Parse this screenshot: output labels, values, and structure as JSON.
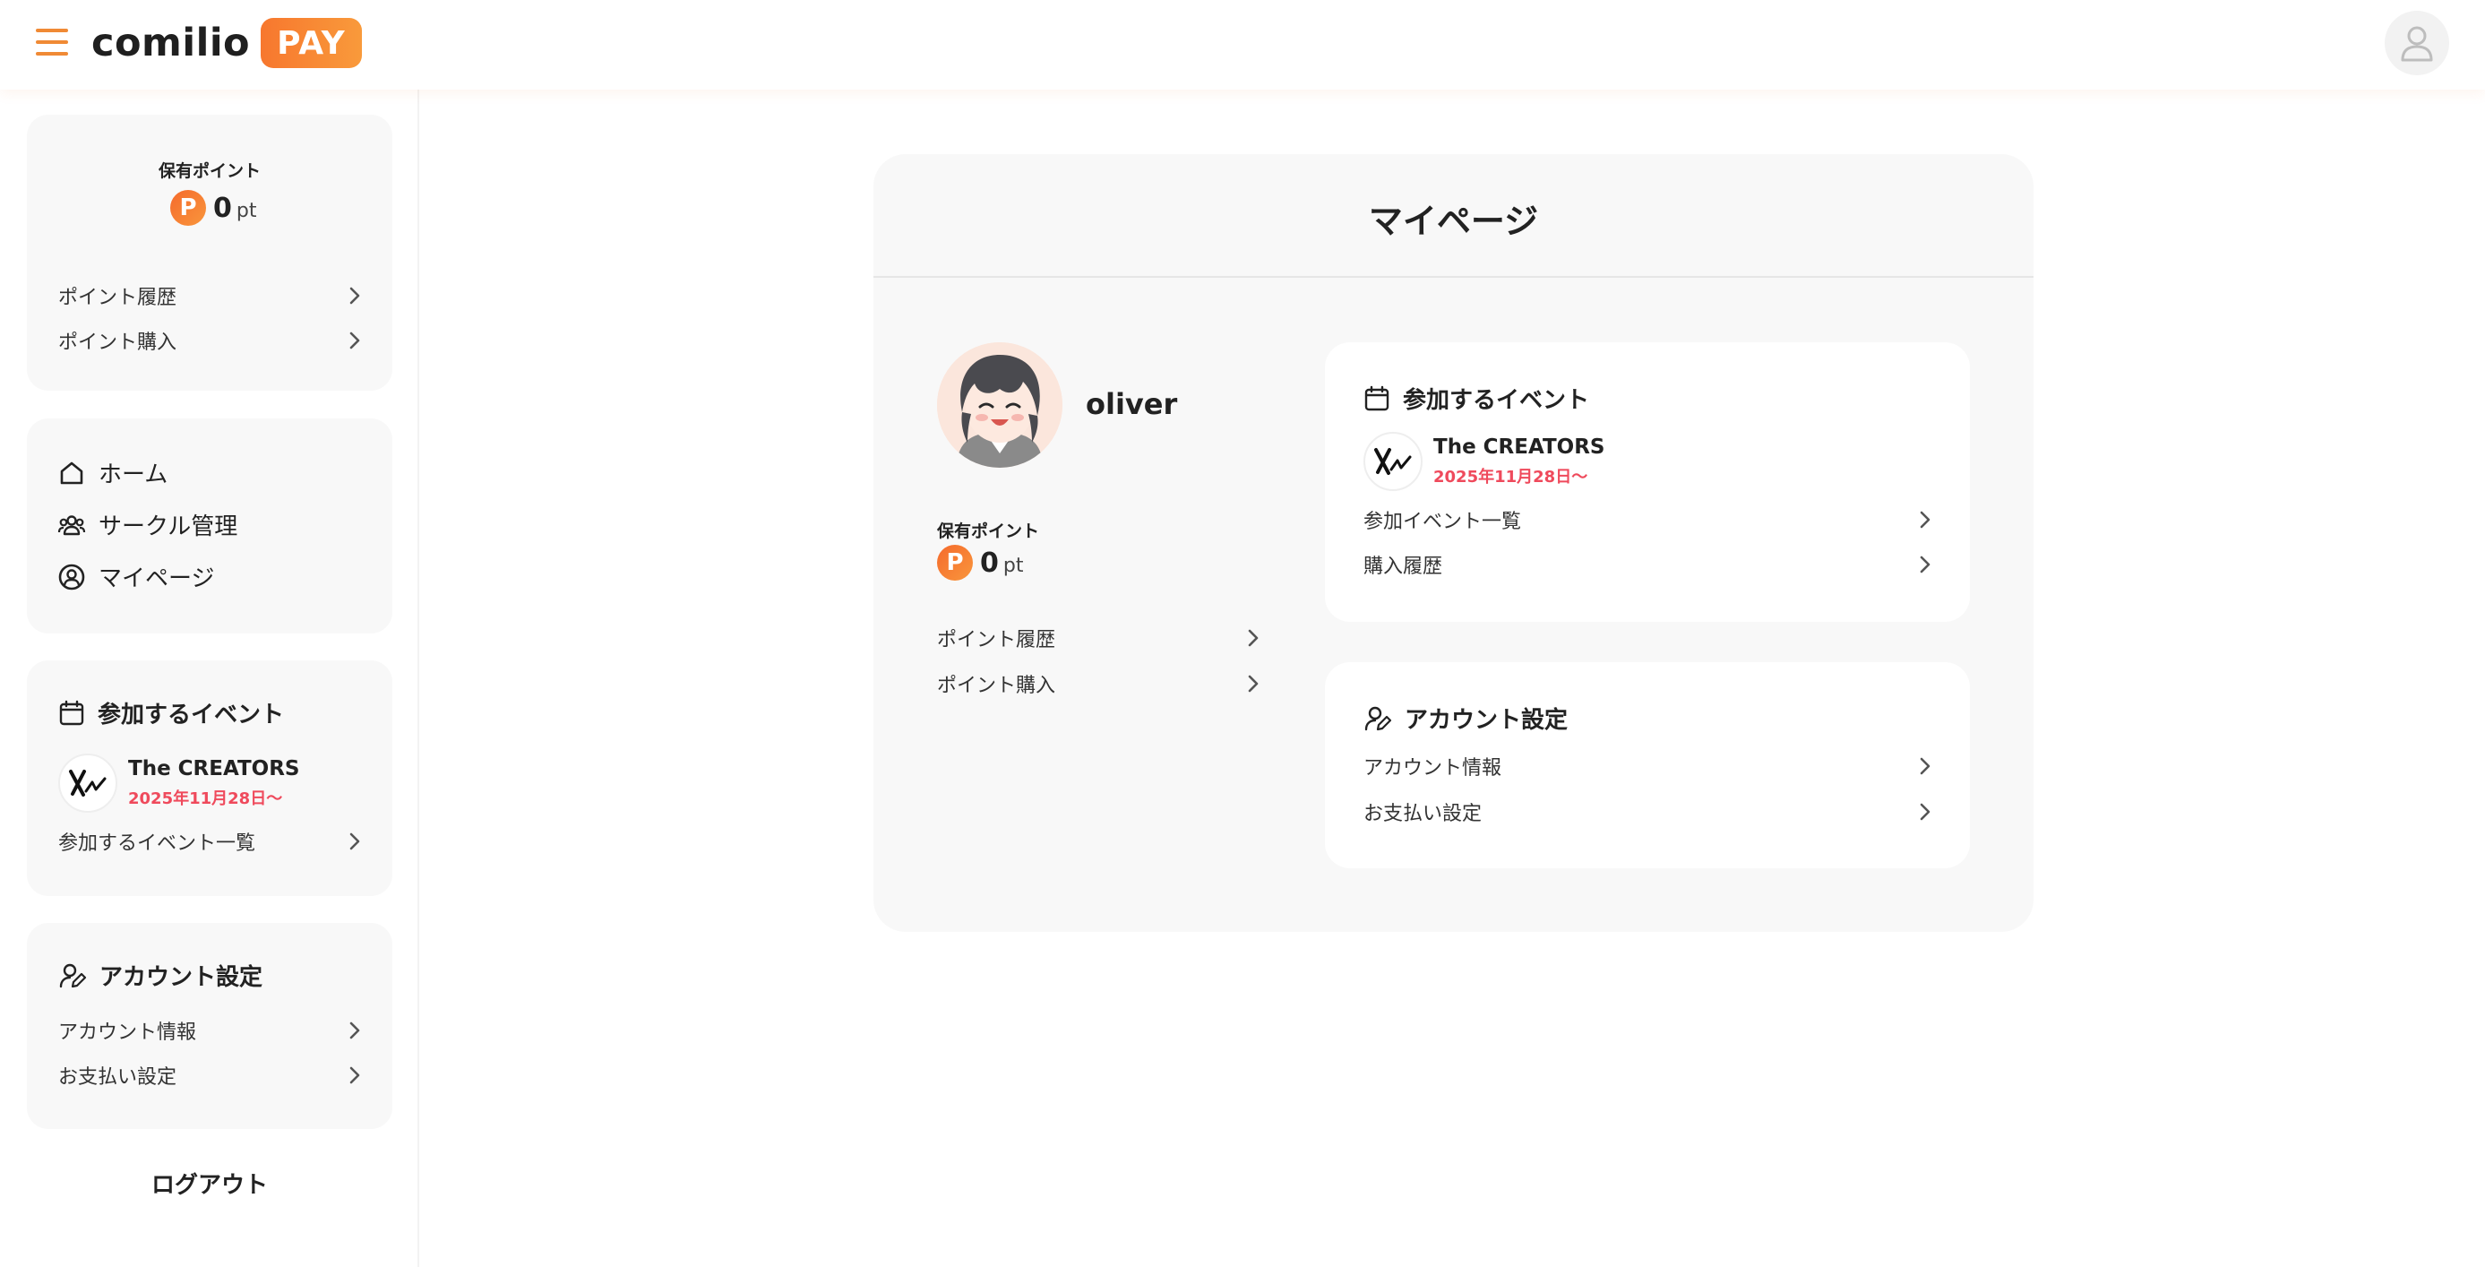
{
  "header": {
    "logo_word": "comilio",
    "logo_badge": "PAY"
  },
  "sidebar": {
    "points": {
      "label": "保有ポイント",
      "badge": "P",
      "value": "0",
      "unit": "pt",
      "history": "ポイント履歴",
      "purchase": "ポイント購入"
    },
    "nav": {
      "home": "ホーム",
      "circle": "サークル管理",
      "mypage": "マイページ"
    },
    "events": {
      "title": "参加するイベント",
      "event_name": "The CREATORS",
      "event_date": "2025年11月28日〜",
      "list_link": "参加するイベント一覧"
    },
    "account": {
      "title": "アカウント設定",
      "info": "アカウント情報",
      "payment": "お支払い設定"
    },
    "logout": "ログアウト"
  },
  "main": {
    "title": "マイページ",
    "profile": {
      "name": "oliver"
    },
    "points": {
      "label": "保有ポイント",
      "badge": "P",
      "value": "0",
      "unit": "pt",
      "history": "ポイント履歴",
      "purchase": "ポイント購入"
    },
    "events": {
      "title": "参加するイベント",
      "event_name": "The CREATORS",
      "event_date": "2025年11月28日〜",
      "list_link": "参加イベント一覧",
      "purchase_history": "購入履歴"
    },
    "account": {
      "title": "アカウント設定",
      "info": "アカウント情報",
      "payment": "お支払い設定"
    }
  },
  "colors": {
    "accent": "#f08a35",
    "badge_gradient_start": "#f7772e",
    "event_date": "#ef4a5c",
    "card_bg": "#f8f8f8"
  }
}
